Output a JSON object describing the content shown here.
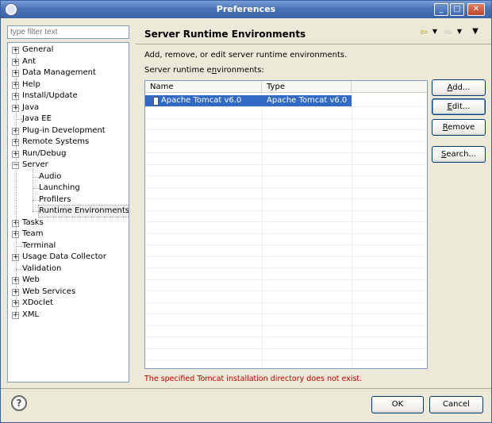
{
  "window": {
    "title": "Preferences"
  },
  "filter": {
    "placeholder": "type filter text"
  },
  "tree": {
    "items": [
      {
        "label": "General",
        "expander": "+"
      },
      {
        "label": "Ant",
        "expander": "+"
      },
      {
        "label": "Data Management",
        "expander": "+"
      },
      {
        "label": "Help",
        "expander": "+"
      },
      {
        "label": "Install/Update",
        "expander": "+"
      },
      {
        "label": "Java",
        "expander": "+"
      },
      {
        "label": "Java EE",
        "expander": ""
      },
      {
        "label": "Plug-in Development",
        "expander": "+"
      },
      {
        "label": "Remote Systems",
        "expander": "+"
      },
      {
        "label": "Run/Debug",
        "expander": "+"
      },
      {
        "label": "Server",
        "expander": "-"
      },
      {
        "label": "Audio",
        "expander": ""
      },
      {
        "label": "Launching",
        "expander": ""
      },
      {
        "label": "Profilers",
        "expander": ""
      },
      {
        "label": "Runtime Environments",
        "expander": ""
      },
      {
        "label": "Tasks",
        "expander": "+"
      },
      {
        "label": "Team",
        "expander": "+"
      },
      {
        "label": "Terminal",
        "expander": ""
      },
      {
        "label": "Usage Data Collector",
        "expander": "+"
      },
      {
        "label": "Validation",
        "expander": ""
      },
      {
        "label": "Web",
        "expander": "+"
      },
      {
        "label": "Web Services",
        "expander": "+"
      },
      {
        "label": "XDoclet",
        "expander": "+"
      },
      {
        "label": "XML",
        "expander": "+"
      }
    ]
  },
  "page": {
    "title": "Server Runtime Environments",
    "description": "Add, remove, or edit server runtime environments.",
    "table_label_pre": "Server runtime e",
    "table_label_mnem": "n",
    "table_label_post": "vironments:",
    "columns": [
      "Name",
      "Type"
    ],
    "rows": [
      {
        "name": "Apache Tomcat v6.0",
        "type": "Apache Tomcat v6.0"
      }
    ],
    "error": "The specified Tomcat installation directory does not exist."
  },
  "buttons": {
    "add_mnem": "A",
    "add_rest": "dd...",
    "edit_mnem": "E",
    "edit_rest": "dit...",
    "remove_mnem": "R",
    "remove_rest": "emove",
    "search_mnem": "S",
    "search_rest": "earch...",
    "ok": "OK",
    "cancel": "Cancel"
  },
  "icons": {
    "back": "back-arrow-icon",
    "forward": "forward-arrow-icon",
    "menu": "view-menu-icon",
    "help": "help-icon"
  }
}
